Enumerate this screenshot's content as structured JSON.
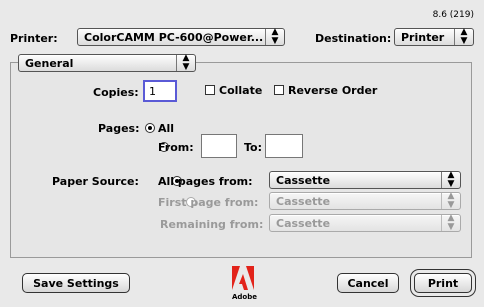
{
  "version": "8.6 (219)",
  "printer": {
    "label": "Printer:",
    "value": "ColorCAMM PC-600@Power..."
  },
  "destination": {
    "label": "Destination:",
    "value": "Printer"
  },
  "panel_menu": {
    "value": "General"
  },
  "copies": {
    "label": "Copies:",
    "value": "1"
  },
  "collate": {
    "label": "Collate",
    "checked": false
  },
  "reverse": {
    "label": "Reverse Order",
    "checked": false
  },
  "pages": {
    "label": "Pages:",
    "all_label": "All",
    "from_label": "From:",
    "to_label": "To:",
    "from_value": "",
    "to_value": "",
    "selected": "All"
  },
  "paper_source": {
    "label": "Paper Source:",
    "all_pages_label": "All pages from:",
    "all_pages_value": "Cassette",
    "first_page_label": "First page from:",
    "first_page_value": "Cassette",
    "remaining_label": "Remaining from:",
    "remaining_value": "Cassette"
  },
  "footer": {
    "save_settings": "Save Settings",
    "cancel": "Cancel",
    "print": "Print",
    "logo_text": "Adobe"
  },
  "icons": {
    "popup_arrow": "updown-arrows-icon",
    "logo": "adobe-logo-icon"
  }
}
